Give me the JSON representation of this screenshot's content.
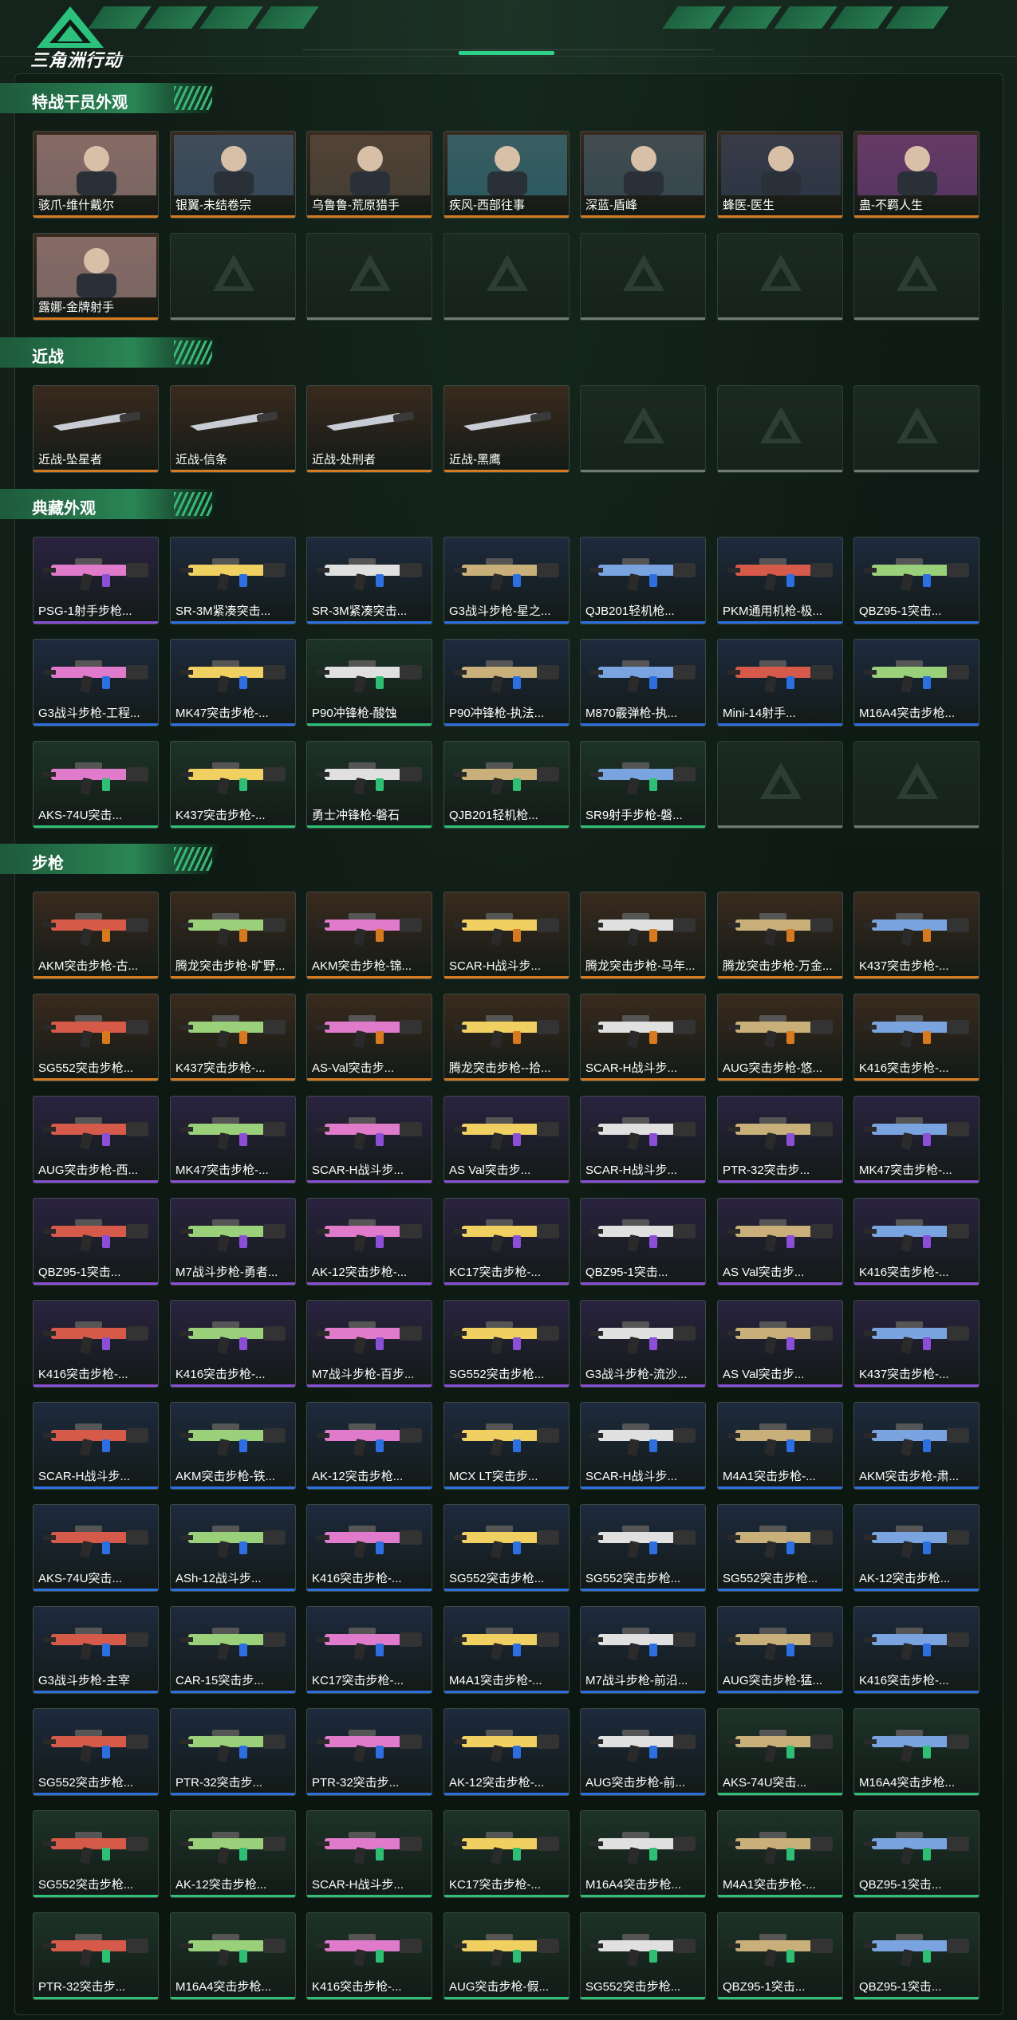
{
  "header": {
    "logo_text": "三角洲行动"
  },
  "colors": {
    "orange": "#d77a1f",
    "blue": "#2d6fe0",
    "purple": "#8a4fd6",
    "green": "#2fbf74",
    "gold_bg": "#3a2a1e",
    "orange_bg": "#3a2a1e",
    "blue_bg": "#1e2a3e",
    "purple_bg": "#2a2340",
    "green_bg": "#1d3328"
  },
  "sections": [
    {
      "title": "特战干员外观",
      "rows": [
        [
          {
            "name": "骇爪-维什戴尔",
            "rarity": "orange",
            "kind": "operator"
          },
          {
            "name": "银翼-未结卷宗",
            "rarity": "orange",
            "kind": "operator"
          },
          {
            "name": "乌鲁鲁-荒原猎手",
            "rarity": "orange",
            "kind": "operator"
          },
          {
            "name": "疾风-西部往事",
            "rarity": "orange",
            "kind": "operator"
          },
          {
            "name": "深蓝-盾峰",
            "rarity": "orange",
            "kind": "operator"
          },
          {
            "name": "蜂医-医生",
            "rarity": "orange",
            "kind": "operator"
          },
          {
            "name": "蛊-不羁人生",
            "rarity": "orange",
            "kind": "operator"
          }
        ],
        [
          {
            "name": "露娜-金牌射手",
            "rarity": "orange",
            "kind": "operator"
          },
          null,
          null,
          null,
          null,
          null,
          null
        ]
      ]
    },
    {
      "title": "近战",
      "rows": [
        [
          {
            "name": "近战-坠星者",
            "rarity": "orange",
            "kind": "melee"
          },
          {
            "name": "近战-信条",
            "rarity": "orange",
            "kind": "melee"
          },
          {
            "name": "近战-处刑者",
            "rarity": "orange",
            "kind": "melee"
          },
          {
            "name": "近战-黑鹰",
            "rarity": "orange",
            "kind": "melee"
          },
          null,
          null,
          null
        ]
      ]
    },
    {
      "title": "典藏外观",
      "rows": [
        [
          {
            "name": "PSG-1射手步枪...",
            "rarity": "purple",
            "kind": "gun"
          },
          {
            "name": "SR-3M紧凑突击...",
            "rarity": "blue",
            "kind": "gun"
          },
          {
            "name": "SR-3M紧凑突击...",
            "rarity": "blue",
            "kind": "gun"
          },
          {
            "name": "G3战斗步枪-星之...",
            "rarity": "blue",
            "kind": "gun"
          },
          {
            "name": "QJB201轻机枪...",
            "rarity": "blue",
            "kind": "gun"
          },
          {
            "name": "PKM通用机枪-极...",
            "rarity": "blue",
            "kind": "gun"
          },
          {
            "name": "QBZ95-1突击...",
            "rarity": "blue",
            "kind": "gun"
          }
        ],
        [
          {
            "name": "G3战斗步枪-工程...",
            "rarity": "blue",
            "kind": "gun"
          },
          {
            "name": "MK47突击步枪-...",
            "rarity": "blue",
            "kind": "gun"
          },
          {
            "name": "P90冲锋枪-酸蚀",
            "rarity": "green",
            "kind": "gun"
          },
          {
            "name": "P90冲锋枪-执法...",
            "rarity": "blue",
            "kind": "gun"
          },
          {
            "name": "M870霰弹枪-执...",
            "rarity": "blue",
            "kind": "gun"
          },
          {
            "name": "Mini-14射手...",
            "rarity": "blue",
            "kind": "gun"
          },
          {
            "name": "M16A4突击步枪...",
            "rarity": "blue",
            "kind": "gun"
          }
        ],
        [
          {
            "name": "AKS-74U突击...",
            "rarity": "green",
            "kind": "gun"
          },
          {
            "name": "K437突击步枪-...",
            "rarity": "green",
            "kind": "gun"
          },
          {
            "name": "勇士冲锋枪-磐石",
            "rarity": "green",
            "kind": "gun"
          },
          {
            "name": "QJB201轻机枪...",
            "rarity": "green",
            "kind": "gun"
          },
          {
            "name": "SR9射手步枪-磐...",
            "rarity": "green",
            "kind": "gun"
          },
          null,
          null
        ]
      ]
    },
    {
      "title": "步枪",
      "rows": [
        [
          {
            "name": "AKM突击步枪-古...",
            "rarity": "orange",
            "kind": "gun"
          },
          {
            "name": "腾龙突击步枪-旷野...",
            "rarity": "orange",
            "kind": "gun"
          },
          {
            "name": "AKM突击步枪-锦...",
            "rarity": "orange",
            "kind": "gun"
          },
          {
            "name": "SCAR-H战斗步...",
            "rarity": "orange",
            "kind": "gun"
          },
          {
            "name": "腾龙突击步枪-马年...",
            "rarity": "orange",
            "kind": "gun"
          },
          {
            "name": "腾龙突击步枪-万金...",
            "rarity": "orange",
            "kind": "gun"
          },
          {
            "name": "K437突击步枪-...",
            "rarity": "orange",
            "kind": "gun"
          }
        ],
        [
          {
            "name": "SG552突击步枪...",
            "rarity": "orange",
            "kind": "gun"
          },
          {
            "name": "K437突击步枪-...",
            "rarity": "orange",
            "kind": "gun"
          },
          {
            "name": "AS-Val突击步...",
            "rarity": "orange",
            "kind": "gun"
          },
          {
            "name": "腾龙突击步枪--拾...",
            "rarity": "orange",
            "kind": "gun"
          },
          {
            "name": "SCAR-H战斗步...",
            "rarity": "orange",
            "kind": "gun"
          },
          {
            "name": "AUG突击步枪-悠...",
            "rarity": "orange",
            "kind": "gun"
          },
          {
            "name": "K416突击步枪-...",
            "rarity": "orange",
            "kind": "gun"
          }
        ],
        [
          {
            "name": "AUG突击步枪-西...",
            "rarity": "purple",
            "kind": "gun"
          },
          {
            "name": "MK47突击步枪-...",
            "rarity": "purple",
            "kind": "gun"
          },
          {
            "name": "SCAR-H战斗步...",
            "rarity": "purple",
            "kind": "gun"
          },
          {
            "name": "AS Val突击步...",
            "rarity": "purple",
            "kind": "gun"
          },
          {
            "name": "SCAR-H战斗步...",
            "rarity": "purple",
            "kind": "gun"
          },
          {
            "name": "PTR-32突击步...",
            "rarity": "purple",
            "kind": "gun"
          },
          {
            "name": "MK47突击步枪-...",
            "rarity": "purple",
            "kind": "gun"
          }
        ],
        [
          {
            "name": "QBZ95-1突击...",
            "rarity": "purple",
            "kind": "gun"
          },
          {
            "name": "M7战斗步枪-勇者...",
            "rarity": "purple",
            "kind": "gun"
          },
          {
            "name": "AK-12突击步枪-...",
            "rarity": "purple",
            "kind": "gun"
          },
          {
            "name": "KC17突击步枪-...",
            "rarity": "purple",
            "kind": "gun"
          },
          {
            "name": "QBZ95-1突击...",
            "rarity": "purple",
            "kind": "gun"
          },
          {
            "name": "AS Val突击步...",
            "rarity": "purple",
            "kind": "gun"
          },
          {
            "name": "K416突击步枪-...",
            "rarity": "purple",
            "kind": "gun"
          }
        ],
        [
          {
            "name": "K416突击步枪-...",
            "rarity": "purple",
            "kind": "gun"
          },
          {
            "name": "K416突击步枪-...",
            "rarity": "purple",
            "kind": "gun"
          },
          {
            "name": "M7战斗步枪-百步...",
            "rarity": "purple",
            "kind": "gun"
          },
          {
            "name": "SG552突击步枪...",
            "rarity": "purple",
            "kind": "gun"
          },
          {
            "name": "G3战斗步枪-流沙...",
            "rarity": "purple",
            "kind": "gun"
          },
          {
            "name": "AS Val突击步...",
            "rarity": "purple",
            "kind": "gun"
          },
          {
            "name": "K437突击步枪-...",
            "rarity": "purple",
            "kind": "gun"
          }
        ],
        [
          {
            "name": "SCAR-H战斗步...",
            "rarity": "blue",
            "kind": "gun"
          },
          {
            "name": "AKM突击步枪-铁...",
            "rarity": "blue",
            "kind": "gun"
          },
          {
            "name": "AK-12突击步枪...",
            "rarity": "blue",
            "kind": "gun"
          },
          {
            "name": "MCX LT突击步...",
            "rarity": "blue",
            "kind": "gun"
          },
          {
            "name": "SCAR-H战斗步...",
            "rarity": "blue",
            "kind": "gun"
          },
          {
            "name": "M4A1突击步枪-...",
            "rarity": "blue",
            "kind": "gun"
          },
          {
            "name": "AKM突击步枪-肃...",
            "rarity": "blue",
            "kind": "gun"
          }
        ],
        [
          {
            "name": "AKS-74U突击...",
            "rarity": "blue",
            "kind": "gun"
          },
          {
            "name": "ASh-12战斗步...",
            "rarity": "blue",
            "kind": "gun"
          },
          {
            "name": "K416突击步枪-...",
            "rarity": "blue",
            "kind": "gun"
          },
          {
            "name": "SG552突击步枪...",
            "rarity": "blue",
            "kind": "gun"
          },
          {
            "name": "SG552突击步枪...",
            "rarity": "blue",
            "kind": "gun"
          },
          {
            "name": "SG552突击步枪...",
            "rarity": "blue",
            "kind": "gun"
          },
          {
            "name": "AK-12突击步枪...",
            "rarity": "blue",
            "kind": "gun"
          }
        ],
        [
          {
            "name": "G3战斗步枪-主宰",
            "rarity": "blue",
            "kind": "gun"
          },
          {
            "name": "CAR-15突击步...",
            "rarity": "blue",
            "kind": "gun"
          },
          {
            "name": "KC17突击步枪-...",
            "rarity": "blue",
            "kind": "gun"
          },
          {
            "name": "M4A1突击步枪-...",
            "rarity": "blue",
            "kind": "gun"
          },
          {
            "name": "M7战斗步枪-前沿...",
            "rarity": "blue",
            "kind": "gun"
          },
          {
            "name": "AUG突击步枪-猛...",
            "rarity": "blue",
            "kind": "gun"
          },
          {
            "name": "K416突击步枪-...",
            "rarity": "blue",
            "kind": "gun"
          }
        ],
        [
          {
            "name": "SG552突击步枪...",
            "rarity": "blue",
            "kind": "gun"
          },
          {
            "name": "PTR-32突击步...",
            "rarity": "blue",
            "kind": "gun"
          },
          {
            "name": "PTR-32突击步...",
            "rarity": "blue",
            "kind": "gun"
          },
          {
            "name": "AK-12突击步枪-...",
            "rarity": "blue",
            "kind": "gun"
          },
          {
            "name": "AUG突击步枪-前...",
            "rarity": "blue",
            "kind": "gun"
          },
          {
            "name": "AKS-74U突击...",
            "rarity": "green",
            "kind": "gun"
          },
          {
            "name": "M16A4突击步枪...",
            "rarity": "green",
            "kind": "gun"
          }
        ],
        [
          {
            "name": "SG552突击步枪...",
            "rarity": "green",
            "kind": "gun"
          },
          {
            "name": "AK-12突击步枪...",
            "rarity": "green",
            "kind": "gun"
          },
          {
            "name": "SCAR-H战斗步...",
            "rarity": "green",
            "kind": "gun"
          },
          {
            "name": "KC17突击步枪-...",
            "rarity": "green",
            "kind": "gun"
          },
          {
            "name": "M16A4突击步枪...",
            "rarity": "green",
            "kind": "gun"
          },
          {
            "name": "M4A1突击步枪-...",
            "rarity": "green",
            "kind": "gun"
          },
          {
            "name": "QBZ95-1突击...",
            "rarity": "green",
            "kind": "gun"
          }
        ],
        [
          {
            "name": "PTR-32突击步...",
            "rarity": "green",
            "kind": "gun"
          },
          {
            "name": "M16A4突击步枪...",
            "rarity": "green",
            "kind": "gun"
          },
          {
            "name": "K416突击步枪-...",
            "rarity": "green",
            "kind": "gun"
          },
          {
            "name": "AUG突击步枪-假...",
            "rarity": "green",
            "kind": "gun"
          },
          {
            "name": "SG552突击步枪...",
            "rarity": "green",
            "kind": "gun"
          },
          {
            "name": "QBZ95-1突击...",
            "rarity": "green",
            "kind": "gun"
          },
          {
            "name": "QBZ95-1突击...",
            "rarity": "green",
            "kind": "gun"
          }
        ]
      ]
    }
  ]
}
